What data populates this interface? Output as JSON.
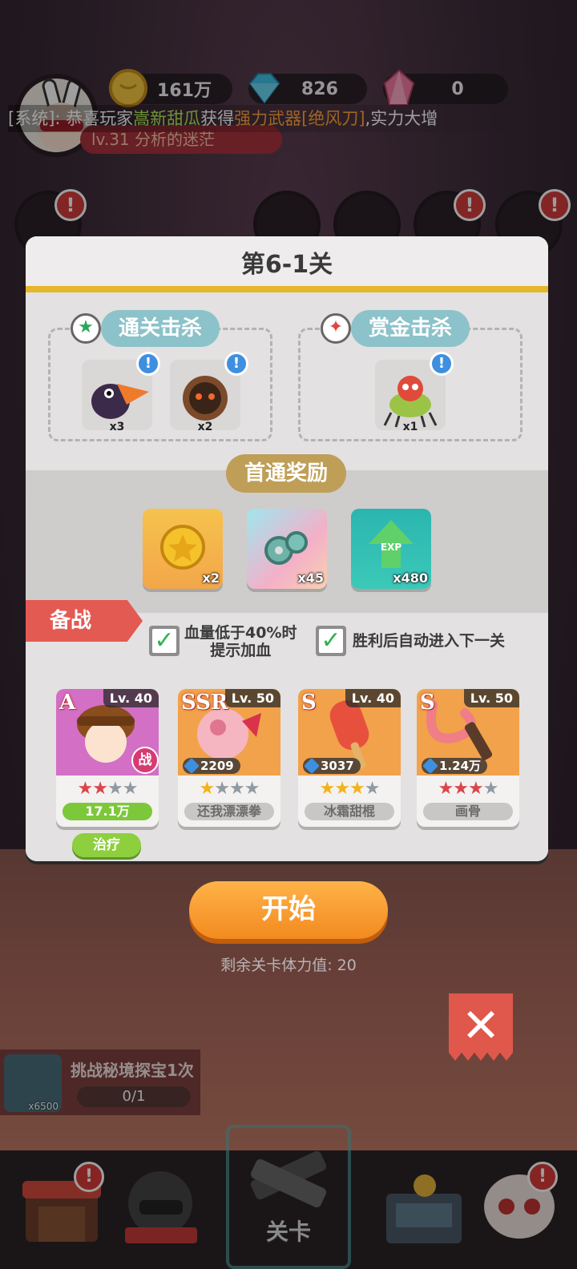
{
  "topbar": {
    "coins": "161万",
    "gems": "826",
    "crystals": "0",
    "level_tag": "lv.31 分析的迷茫",
    "system_message": {
      "prefix": "[系统]: 恭喜玩家",
      "player": "嵩新甜瓜",
      "middle": "获得",
      "item": "强力武器[绝风刀]",
      "suffix": ",实力大增"
    }
  },
  "modal": {
    "title": "第6-1关",
    "clear_kill": {
      "label": "通关击杀",
      "enemies": [
        {
          "name": "toucan-monster",
          "count": "x3"
        },
        {
          "name": "spiky-seed-monster",
          "count": "x2"
        }
      ]
    },
    "bounty_kill": {
      "label": "赏金击杀",
      "enemies": [
        {
          "name": "flytrap-spider-monster",
          "count": "x1"
        }
      ]
    },
    "first_clear": {
      "label": "首通奖励",
      "rewards": [
        {
          "name": "gold-coin",
          "count": "x2"
        },
        {
          "name": "gears",
          "count": "x45"
        },
        {
          "name": "exp",
          "count": "x480",
          "icon_text": "EXP"
        }
      ]
    },
    "prep": {
      "label": "备战",
      "option1": {
        "line1": "血量低于40%时",
        "line2": "提示加血",
        "checked": true
      },
      "option2": {
        "label": "胜利后自动进入下一关",
        "checked": true
      },
      "battle_tag": "战",
      "heroes": [
        {
          "rank": "A",
          "level": "Lv. 40",
          "stars": [
            1,
            1,
            0,
            0
          ],
          "bar": "17.1万",
          "bar_style": "green",
          "power": ""
        },
        {
          "rank": "SSR",
          "level": "Lv. 50",
          "stars": [
            1,
            0,
            0,
            0
          ],
          "bar": "还我漂漂拳",
          "bar_style": "gray",
          "power": "2209"
        },
        {
          "rank": "S",
          "level": "Lv. 40",
          "stars": [
            1,
            1,
            1,
            0
          ],
          "bar": "冰霜甜棍",
          "bar_style": "gray",
          "power": "3037"
        },
        {
          "rank": "S",
          "level": "Lv. 50",
          "stars": [
            1,
            1,
            1,
            0
          ],
          "bar": "画骨",
          "bar_style": "gray",
          "power": "1.24万"
        }
      ],
      "heal_button": "治疗"
    }
  },
  "start_button": "开始",
  "stamina_text": "剩余关卡体力值: 20",
  "quest": {
    "title": "挑战秘境探宝1次",
    "progress": "0/1",
    "reward_count": "x6500"
  },
  "bottom_nav": {
    "center_label": "关卡",
    "badge": "!"
  },
  "colors": {
    "accent_orange": "#f28a1f",
    "prep_red": "#e35a53",
    "reward_gold": "#bf9f57",
    "pill_teal": "#8cc2ca",
    "check_green": "#2fb34c"
  }
}
